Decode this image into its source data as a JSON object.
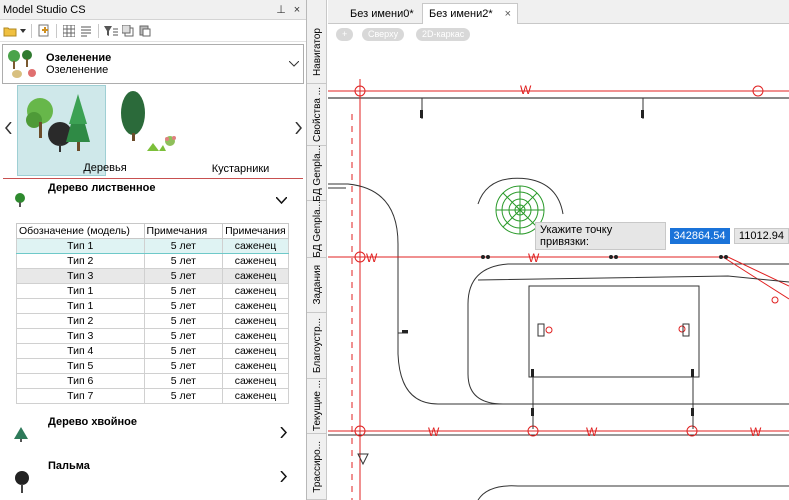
{
  "app": {
    "title": "Model Studio CS",
    "pin": "⊥",
    "close": "×"
  },
  "category": {
    "title": "Озеленение",
    "subtitle": "Озеленение"
  },
  "gallery": {
    "items": [
      {
        "label": "Деревья"
      },
      {
        "label": "Кустарники"
      }
    ]
  },
  "groups": [
    {
      "title": "Дерево лиственное"
    },
    {
      "title": "Дерево хвойное"
    },
    {
      "title": "Пальма"
    }
  ],
  "table": {
    "headers": [
      "Обозначение (модель)",
      "Примечания",
      "Примечания"
    ],
    "rows": [
      [
        "Тип 1",
        "5 лет",
        "саженец"
      ],
      [
        "Тип 2",
        "5 лет",
        "саженец"
      ],
      [
        "Тип 3",
        "5 лет",
        "саженец"
      ],
      [
        "Тип 1",
        "5 лет",
        "саженец"
      ],
      [
        "Тип 1",
        "5 лет",
        "саженец"
      ],
      [
        "Тип 2",
        "5 лет",
        "саженец"
      ],
      [
        "Тип 3",
        "5 лет",
        "саженец"
      ],
      [
        "Тип 4",
        "5 лет",
        "саженец"
      ],
      [
        "Тип 5",
        "5 лет",
        "саженец"
      ],
      [
        "Тип 6",
        "5 лет",
        "саженец"
      ],
      [
        "Тип 7",
        "5 лет",
        "саженец"
      ]
    ]
  },
  "side_tabs": [
    "Навигатор",
    "Свойства ...",
    "БД Genpla...",
    "БД Genpla...",
    "Задания",
    "Благоустр...",
    "Текущие ...",
    "Трассиро..."
  ],
  "doc_tabs": [
    {
      "label": "Без имени0*"
    },
    {
      "label": "Без имени2*",
      "close": "×"
    }
  ],
  "view_buttons": [
    "+",
    "Сверху",
    "2D-каркас"
  ],
  "snap": {
    "prompt": "Укажите точку привязки:",
    "x": "342864.54",
    "y": "11012.94"
  },
  "canvas": {
    "marker": "W"
  },
  "colors": {
    "selection": "#cfe8ea",
    "cad_red": "#e02020",
    "coord_highlight": "#1a73d9"
  }
}
